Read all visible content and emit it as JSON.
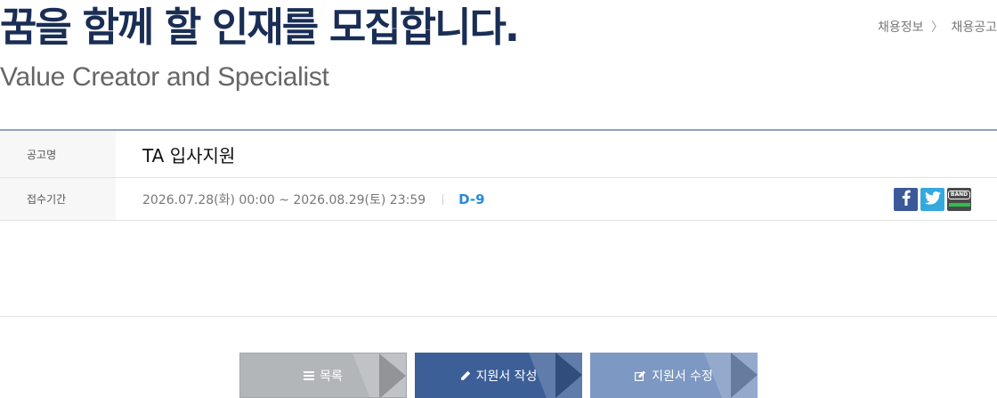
{
  "header": {
    "title": "꿈을 함께 할 인재를 모집합니다.",
    "subtitle": "Value Creator and Specialist",
    "breadcrumb": [
      "채용정보",
      "채용공고"
    ],
    "breadcrumb_sep": "〉"
  },
  "posting": {
    "title_label": "공고명",
    "title_value": "TA 입사지원",
    "period_label": "접수기간",
    "period_value": "2026.07.28(화) 00:00 ~ 2026.08.29(토) 23:59",
    "dday": "D-9"
  },
  "share": {
    "icons": [
      "facebook-icon",
      "twitter-icon",
      "band-icon"
    ],
    "band_label": "BAND",
    "colors": {
      "facebook": "#3b5998",
      "twitter": "#35a8e0",
      "band": "#4a4a4a"
    }
  },
  "actions": {
    "list_label": "목록",
    "apply_label": "지원서 작성",
    "edit_label": "지원서 수정"
  },
  "colors": {
    "title": "#1a2e55",
    "dday": "#2a8ad8",
    "btn_list": "#b3b6b9",
    "btn_apply": "#3d5f98",
    "btn_edit": "#7d98c2"
  }
}
